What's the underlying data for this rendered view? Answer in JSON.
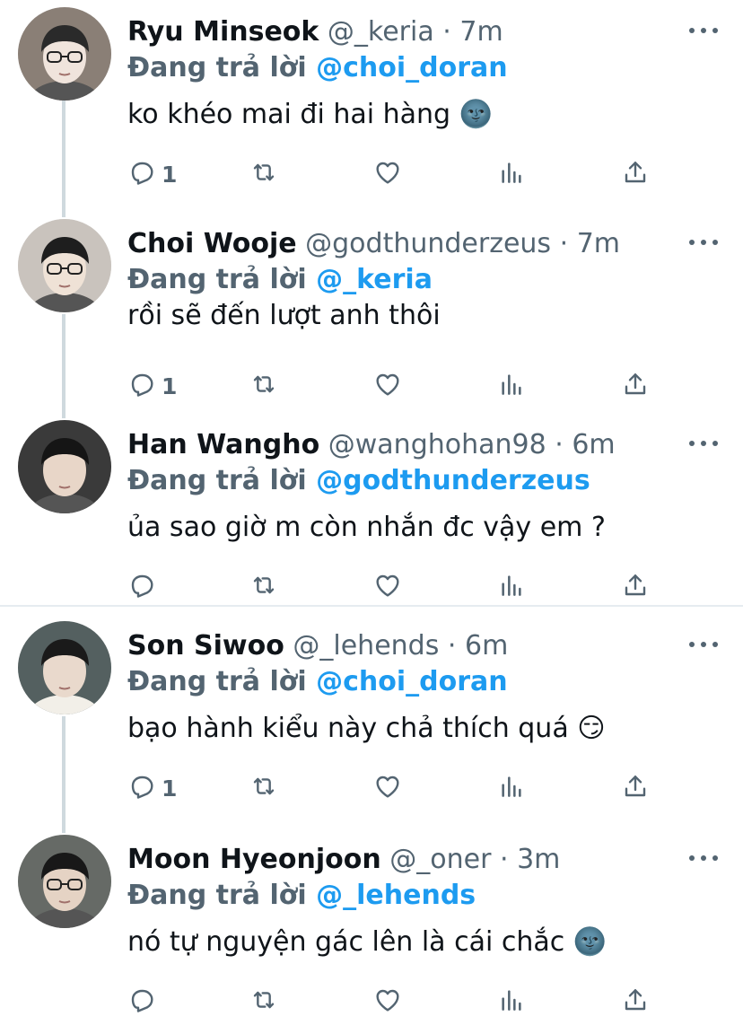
{
  "labels": {
    "replying_to": "Đang trả lời"
  },
  "colors": {
    "name": "#0f1419",
    "muted": "#536471",
    "link": "#1d9bf0",
    "thread_line": "#cfd9de"
  },
  "tweets": [
    {
      "name": "Ryu Minseok",
      "handle": "@_keria",
      "separator": "·",
      "time": "7m",
      "reply_to": "@choi_doran",
      "text": "ko khéo mai đi hai hàng 🌚",
      "reply_count": "1",
      "avatar_icon": "avatar-photo"
    },
    {
      "name": "Choi Wooje",
      "handle": "@godthunderzeus",
      "separator": "·",
      "time": "7m",
      "reply_to": "@_keria",
      "text": "rồi sẽ đến lượt anh thôi",
      "reply_count": "1",
      "avatar_icon": "avatar-photo"
    },
    {
      "name": "Han Wangho",
      "handle": "@wanghohan98",
      "separator": "·",
      "time": "6m",
      "reply_to": "@godthunderzeus",
      "text": "ủa sao giờ m còn nhắn đc vậy em ?",
      "reply_count": "",
      "avatar_icon": "avatar-photo"
    },
    {
      "name": "Son Siwoo",
      "handle": "@_lehends",
      "separator": "·",
      "time": "6m",
      "reply_to": "@choi_doran",
      "text": "bạo hành kiểu này chả thích quá 😏",
      "reply_count": "1",
      "avatar_icon": "avatar-photo"
    },
    {
      "name": "Moon Hyeonjoon",
      "handle": "@_oner",
      "separator": "·",
      "time": "3m",
      "reply_to": "@_lehends",
      "text": "nó tự nguyện gác lên là cái chắc 🌚",
      "reply_count": "",
      "avatar_icon": "avatar-photo"
    }
  ]
}
